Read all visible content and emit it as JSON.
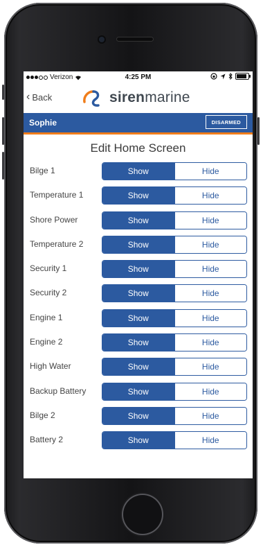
{
  "status_bar": {
    "carrier": "Verizon",
    "time": "4:25 PM"
  },
  "nav": {
    "back_label": "Back",
    "logo_bold": "siren",
    "logo_light": "marine"
  },
  "user_bar": {
    "name": "Sophie",
    "status_badge": "DISARMED"
  },
  "page": {
    "title": "Edit Home Screen"
  },
  "toggle_labels": {
    "show": "Show",
    "hide": "Hide"
  },
  "items": [
    {
      "label": "Bilge 1",
      "selected": "Show"
    },
    {
      "label": "Temperature 1",
      "selected": "Show"
    },
    {
      "label": "Shore Power",
      "selected": "Show"
    },
    {
      "label": "Temperature 2",
      "selected": "Show"
    },
    {
      "label": "Security 1",
      "selected": "Show"
    },
    {
      "label": "Security 2",
      "selected": "Show"
    },
    {
      "label": "Engine 1",
      "selected": "Show"
    },
    {
      "label": "Engine 2",
      "selected": "Show"
    },
    {
      "label": "High Water",
      "selected": "Show"
    },
    {
      "label": "Backup Battery",
      "selected": "Show"
    },
    {
      "label": "Bilge 2",
      "selected": "Show"
    },
    {
      "label": "Battery 2",
      "selected": "Show"
    }
  ],
  "colors": {
    "primary_blue": "#2c5aa0",
    "accent_orange": "#f07d1a",
    "phone_body": "#1a1a1c"
  }
}
